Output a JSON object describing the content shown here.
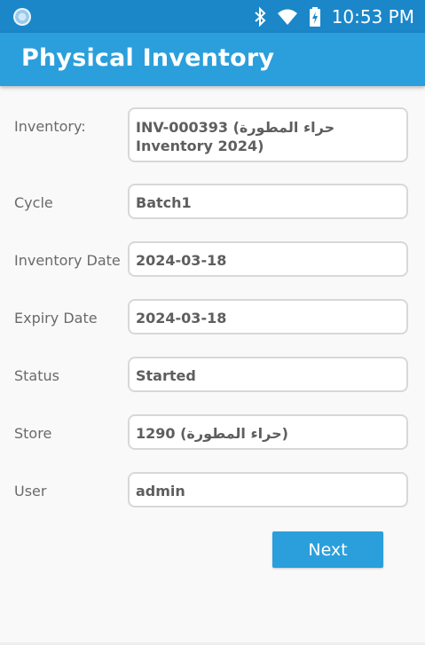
{
  "status_bar": {
    "time": "10:53 PM",
    "icons": [
      "app-notification-icon",
      "bluetooth-icon",
      "wifi-icon",
      "battery-charging-icon"
    ]
  },
  "app_bar": {
    "title": "Physical Inventory"
  },
  "form": {
    "inventory": {
      "label": "Inventory:",
      "value": "INV-000393 (حراء المطورة Inventory 2024)"
    },
    "cycle": {
      "label": "Cycle",
      "value": "Batch1"
    },
    "inventory_date": {
      "label": "Inventory Date",
      "value": "2024-03-18"
    },
    "expiry_date": {
      "label": "Expiry Date",
      "value": "2024-03-18"
    },
    "status": {
      "label": "Status",
      "value": "Started"
    },
    "store": {
      "label": "Store",
      "value": "1290 (حراء المطورة)"
    },
    "user": {
      "label": "User",
      "value": "admin"
    }
  },
  "actions": {
    "next_label": "Next"
  },
  "colors": {
    "status_bar": "#1b87c9",
    "app_bar": "#2a9fdc",
    "button": "#2a9fdc"
  }
}
